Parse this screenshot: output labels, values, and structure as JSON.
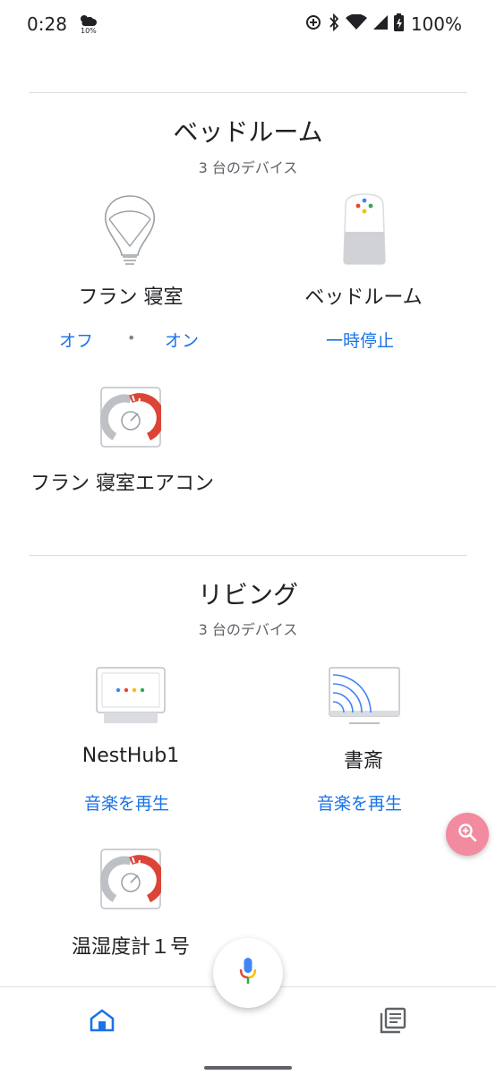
{
  "status_bar": {
    "time": "0:28",
    "weather_percent": "10%",
    "battery_text": "100%"
  },
  "rooms": [
    {
      "title": "ベッドルーム",
      "subtitle": "3 台のデバイス",
      "devices": [
        {
          "name": "フラン 寝室",
          "icon": "bulb-icon",
          "actions": [
            "オフ",
            "オン"
          ]
        },
        {
          "name": "ベッドルーム",
          "icon": "google-home-speaker-icon",
          "actions": [
            "一時停止"
          ]
        },
        {
          "name": "フラン 寝室エアコン",
          "icon": "gauge-icon",
          "actions": []
        }
      ]
    },
    {
      "title": "リビング",
      "subtitle": "3 台のデバイス",
      "devices": [
        {
          "name": "NestHub1",
          "icon": "nest-hub-icon",
          "actions": [
            "音楽を再生"
          ]
        },
        {
          "name": "書斎",
          "icon": "cast-tv-icon",
          "actions": [
            "音楽を再生"
          ]
        },
        {
          "name": "温湿度計１号",
          "icon": "gauge-icon",
          "actions": []
        }
      ]
    }
  ],
  "fab": {
    "zoom_icon": "zoom-in-icon",
    "mic_icon": "microphone-icon"
  },
  "bottom_nav": {
    "home_icon": "home-icon",
    "feed_icon": "feed-icon"
  },
  "colors": {
    "accent": "#1a73e8",
    "zoom_fab": "#f28b9f",
    "gauge_red": "#db4437",
    "google_blue": "#4285f4",
    "google_red": "#ea4335",
    "google_yellow": "#fbbc04",
    "google_green": "#34a853"
  }
}
